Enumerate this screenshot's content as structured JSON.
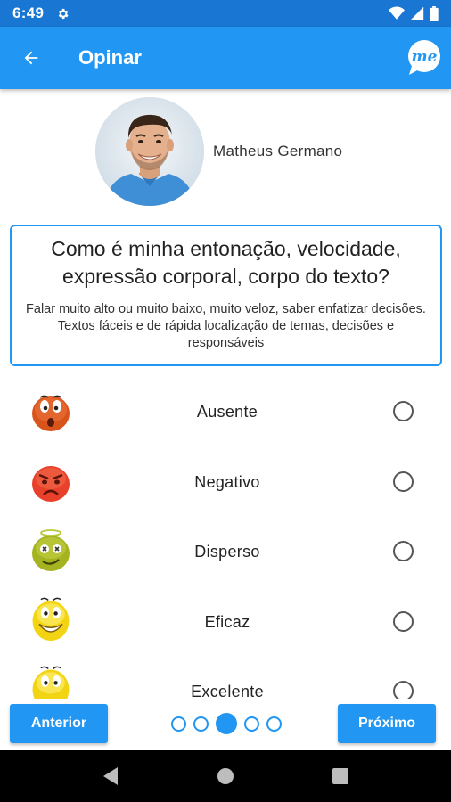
{
  "status_bar": {
    "time": "6:49"
  },
  "header": {
    "title": "Opinar",
    "logo_text": "me"
  },
  "profile": {
    "name": "Matheus Germano"
  },
  "question": {
    "title": "Como é minha entonação, velocidade, expressão corporal, corpo do texto?",
    "description": "Falar muito alto ou muito baixo, muito veloz, saber enfatizar decisões. Textos fáceis e de rápida localização de temas, decisões e responsáveis"
  },
  "options": [
    {
      "label": "Ausente",
      "icon": "surprised-emoji-icon",
      "color": "#d9541a"
    },
    {
      "label": "Negativo",
      "icon": "angry-emoji-icon",
      "color": "#e8402a"
    },
    {
      "label": "Disperso",
      "icon": "dizzy-emoji-icon",
      "color": "#a5b320"
    },
    {
      "label": "Eficaz",
      "icon": "happy-emoji-icon",
      "color": "#f2d413"
    },
    {
      "label": "Excelente",
      "icon": "excited-emoji-icon",
      "color": "#f2d413"
    }
  ],
  "navigation": {
    "prev_label": "Anterior",
    "next_label": "Próximo",
    "total_pages": 5,
    "current_page": 3
  },
  "colors": {
    "primary": "#2196f3",
    "status_bar": "#1976d2"
  }
}
